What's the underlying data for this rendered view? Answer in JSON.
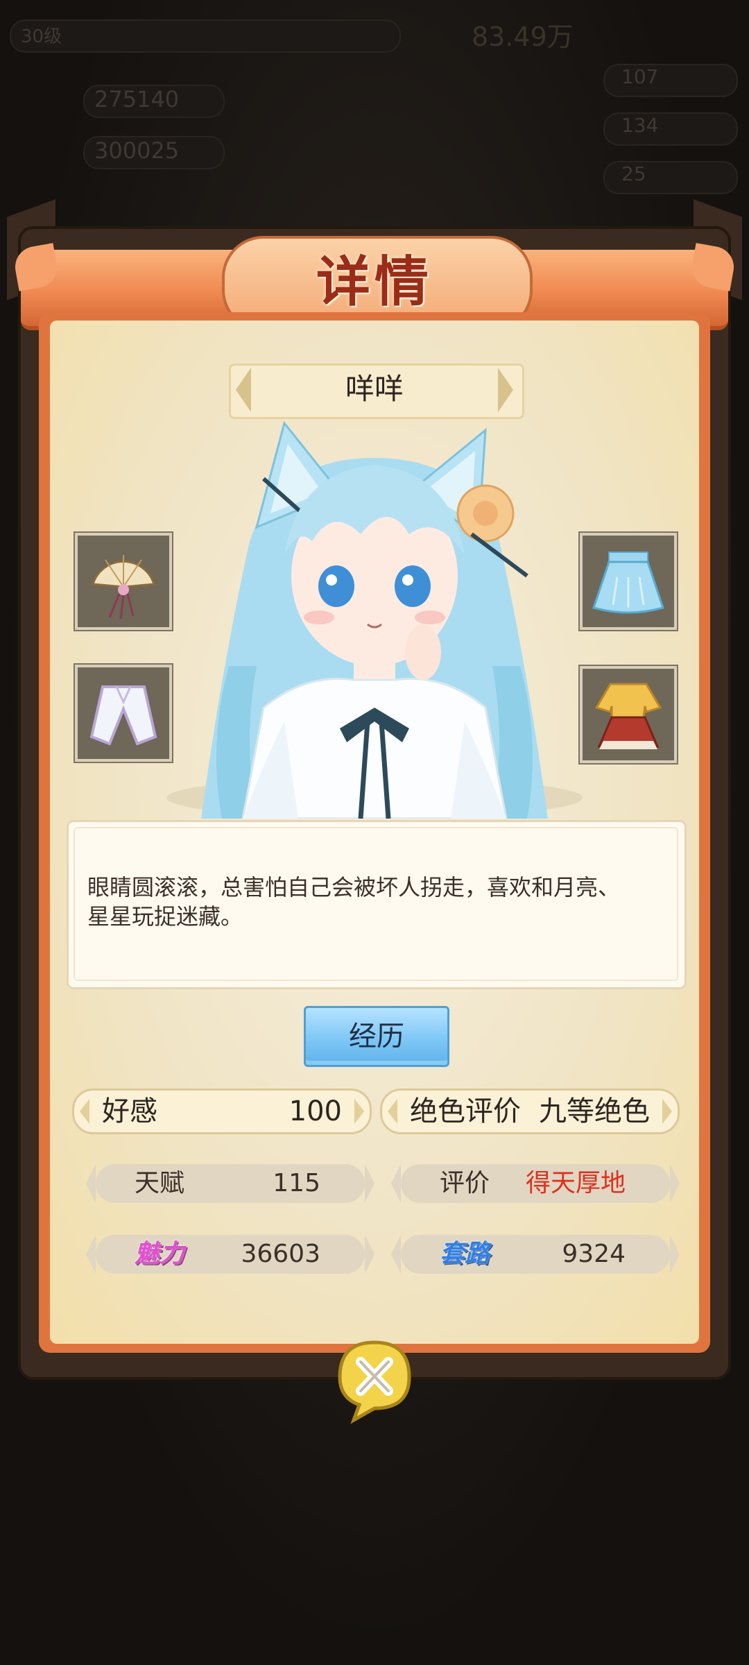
{
  "background": {
    "level_badge": "30级",
    "gold": "83.49万",
    "power_1": "275140",
    "power_2": "300025",
    "res_1": "107",
    "res_2": "134",
    "res_3": "25"
  },
  "dialog": {
    "title": "详情",
    "character_name": "咩咩",
    "description": "眼睛圆滚滚，总害怕自己会被坏人拐走，喜欢和月亮、星星玩捉迷藏。",
    "history_button": "经历"
  },
  "stats": {
    "favor_label": "好感",
    "favor_value": "100",
    "rating_label": "绝色评价",
    "rating_value": "九等绝色",
    "talent_label": "天赋",
    "talent_value": "115",
    "eval_label": "评价",
    "eval_value": "得天厚地",
    "charm_label": "魅力",
    "charm_value": "36603",
    "trick_label": "套路",
    "trick_value": "9324"
  },
  "colors": {
    "banner": "#f08a52",
    "panel": "#f0e4c4",
    "eval_red": "#e0301e",
    "button_blue": "#7ec7f6"
  }
}
